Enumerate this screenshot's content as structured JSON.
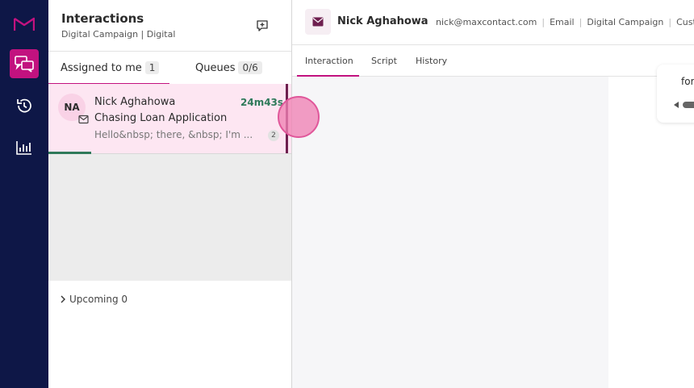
{
  "colors": {
    "rail_bg": "#0e1747",
    "accent": "#c2127f",
    "card_bg": "#fde6f2",
    "timer_green": "#2f7a5a"
  },
  "rail": {
    "items": [
      {
        "name": "logo",
        "icon": "maxcontact-logo-icon"
      },
      {
        "name": "interactions",
        "icon": "chat-bubbles-icon",
        "active": true
      },
      {
        "name": "history",
        "icon": "history-clock-icon"
      },
      {
        "name": "reports",
        "icon": "bar-chart-icon"
      }
    ]
  },
  "panel": {
    "title": "Interactions",
    "subtitle": "Digital Campaign | Digital",
    "new_icon": "new-message-icon",
    "tabs": [
      {
        "label": "Assigned to me",
        "count": "1",
        "active": true
      },
      {
        "label": "Queues",
        "count": "0/6",
        "active": false
      }
    ],
    "card": {
      "initials": "NA",
      "name": "Nick Aghahowa",
      "timer": "24m43s",
      "subject": "Chasing Loan Application",
      "preview": "Hello&nbsp; there, &nbsp; I'm ...",
      "badge": "2",
      "icon": "mail-icon"
    },
    "upcoming": {
      "label": "Upcoming 0"
    }
  },
  "main": {
    "contact_name": "Nick Aghahowa",
    "meta": [
      "nick@maxcontact.com",
      "Email",
      "Digital Campaign",
      "Custo"
    ],
    "tabs": [
      {
        "label": "Interaction",
        "active": true
      },
      {
        "label": "Script",
        "active": false
      },
      {
        "label": "History",
        "active": false
      }
    ],
    "bubble_text": "for"
  }
}
